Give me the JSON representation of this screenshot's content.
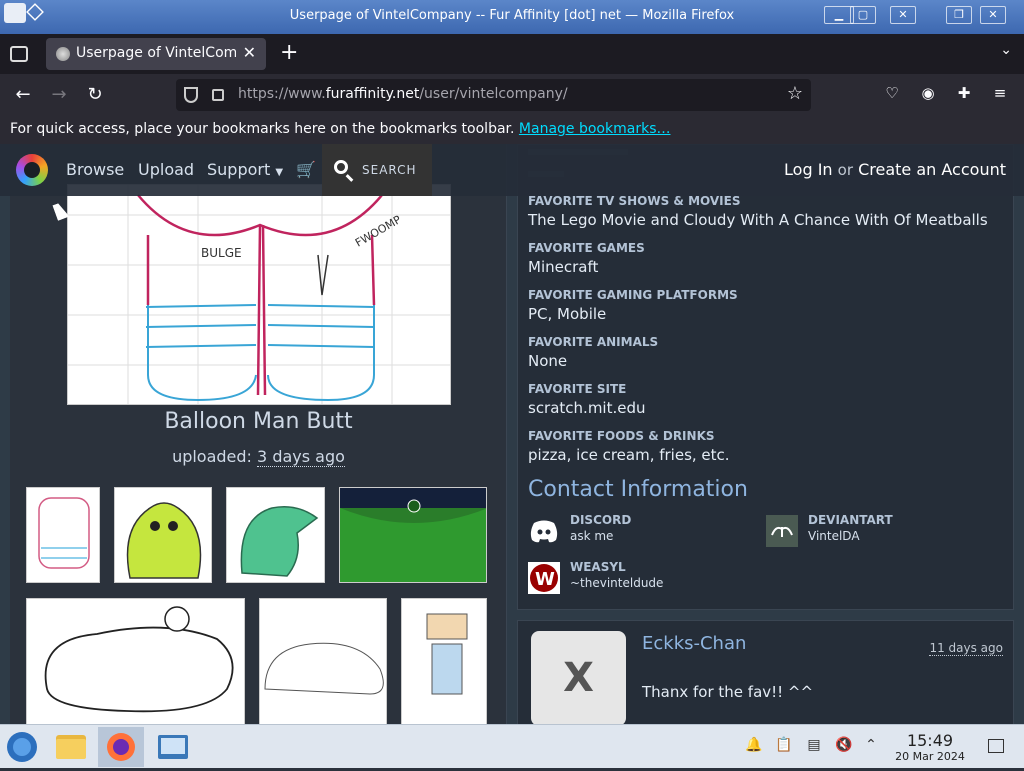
{
  "window": {
    "title": "Userpage of VintelCompany -- Fur Affinity [dot] net — Mozilla Firefox"
  },
  "browser": {
    "tab_label": "Userpage of VintelCompany",
    "url_prefix": "https://www.",
    "url_domain": "furaffinity.net",
    "url_path": "/user/vintelcompany/",
    "bookmarks_text": "For quick access, place your bookmarks here on the bookmarks toolbar.",
    "bookmarks_link": "Manage bookmarks…"
  },
  "sitenav": {
    "browse": "Browse",
    "upload": "Upload",
    "support": "Support",
    "search": "SEARCH",
    "login": "Log In",
    "or": "or",
    "create": "Create an Account"
  },
  "submission": {
    "title": "Balloon Man Butt",
    "uploaded_label": "uploaded:",
    "uploaded_time": "3 days ago"
  },
  "favorites": [
    {
      "label": "FAVORITE TV SHOWS & MOVIES",
      "value": "The Lego Movie and Cloudy With A Chance With Of Meatballs"
    },
    {
      "label": "FAVORITE GAMES",
      "value": "Minecraft"
    },
    {
      "label": "FAVORITE GAMING PLATFORMS",
      "value": "PC, Mobile"
    },
    {
      "label": "FAVORITE ANIMALS",
      "value": "None"
    },
    {
      "label": "FAVORITE SITE",
      "value": "scratch.mit.edu"
    },
    {
      "label": "FAVORITE FOODS & DRINKS",
      "value": "pizza, ice cream, fries, etc."
    }
  ],
  "contact": {
    "title": "Contact Information",
    "items": [
      {
        "service": "DISCORD",
        "value": "ask me"
      },
      {
        "service": "DEVIANTART",
        "value": "VintelDA"
      },
      {
        "service": "WEASYL",
        "value": "~thevinteldude"
      }
    ]
  },
  "comment": {
    "avatar_letter": "X",
    "author": "Eckks-Chan",
    "time": "11 days ago",
    "message": "Thanx for the fav!! ^^"
  },
  "taskbar": {
    "time": "15:49",
    "date": "20 Mar 2024"
  }
}
